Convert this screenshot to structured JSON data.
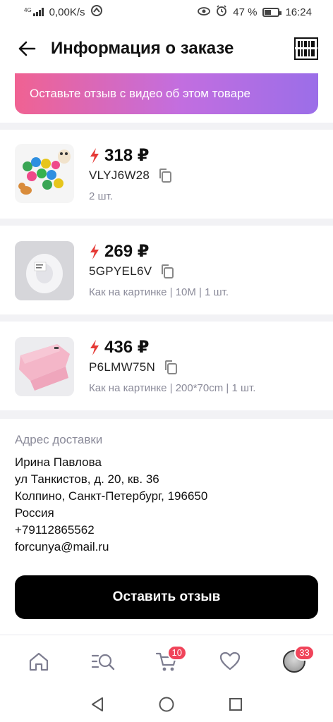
{
  "status_bar": {
    "network_label": "4G",
    "speed": "0,00K/s",
    "battery_percent": "47 %",
    "time": "16:24"
  },
  "header": {
    "title": "Информация о заказе",
    "back_icon": "arrow-left-icon",
    "barcode_icon": "barcode-icon"
  },
  "review_banner": {
    "text": "Оставьте отзыв с видео об этом товаре",
    "gradient": [
      "#f06292",
      "#9b6ee8"
    ]
  },
  "products": [
    {
      "price": "318 ₽",
      "sku": "VLYJ6W28",
      "meta": "2 шт.",
      "image": "cat-toy-balls"
    },
    {
      "price": "269 ₽",
      "sku": "5GPYEL6V",
      "meta": "Как на картинке | 10M | 1 шт.",
      "image": "white-tape-roll"
    },
    {
      "price": "436 ₽",
      "sku": "P6LMW75N",
      "meta": "Как на картинке | 200*70cm | 1 шт.",
      "image": "pink-scarf"
    }
  ],
  "address": {
    "label": "Адрес доставки",
    "name": "Ирина Павлова",
    "street": "ул Танкистов, д. 20, кв. 36",
    "city": "Колпино, Санкт-Петербург, 196650",
    "country": "Россия",
    "phone": "+79112865562",
    "email": "forcunya@mail.ru"
  },
  "review_button": {
    "label": "Оставить отзыв"
  },
  "bottom_nav": {
    "items": [
      {
        "name": "home",
        "icon": "home-icon"
      },
      {
        "name": "catalog",
        "icon": "catalog-search-icon"
      },
      {
        "name": "cart",
        "icon": "cart-icon",
        "badge": "10"
      },
      {
        "name": "favorites",
        "icon": "heart-icon"
      },
      {
        "name": "profile",
        "icon": "avatar",
        "badge": "33"
      }
    ]
  },
  "colors": {
    "accent": "#f0445a",
    "flash": "#e53935",
    "button": "#000000",
    "muted_text": "#8a8a99"
  }
}
